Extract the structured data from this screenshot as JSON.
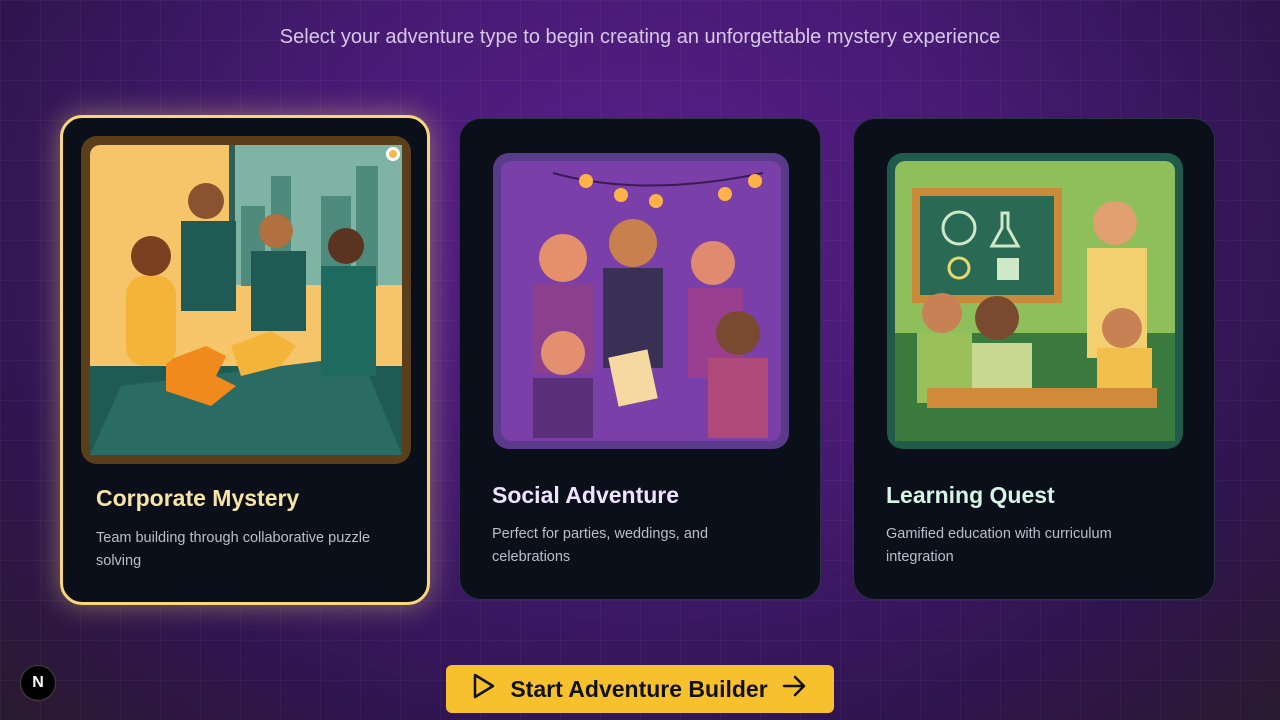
{
  "header": {
    "subtitle": "Select your adventure type to begin creating an unforgettable mystery experience"
  },
  "cards": [
    {
      "title": "Corporate Mystery",
      "description": "Team building through collaborative puzzle solving",
      "selected": true,
      "title_color": "#f8e3a8",
      "image": "team-solving-puzzle-illustration"
    },
    {
      "title": "Social Adventure",
      "description": "Perfect for parties, weddings, and celebrations",
      "selected": false,
      "title_color": "#efe4ff",
      "image": "party-celebration-illustration"
    },
    {
      "title": "Learning Quest",
      "description": "Gamified education with curriculum integration",
      "selected": false,
      "title_color": "#d7f5e6",
      "image": "classroom-teacher-illustration"
    }
  ],
  "cta": {
    "label": "Start Adventure Builder",
    "color": "#f7c12e"
  },
  "badge": {
    "label": "N"
  },
  "colors": {
    "accent": "#f7d77a",
    "card_bg": "#0b0f1a"
  }
}
